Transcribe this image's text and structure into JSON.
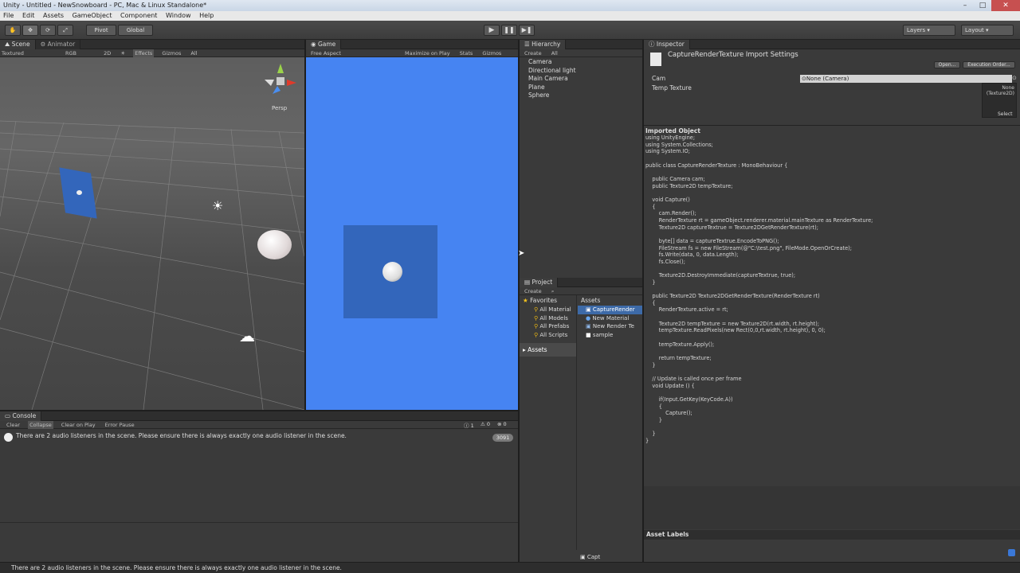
{
  "window": {
    "title": "Unity - Untitled - NewSnowboard - PC, Mac & Linux Standalone*",
    "controls": [
      "–",
      "□",
      "✕"
    ]
  },
  "menu": [
    "File",
    "Edit",
    "Assets",
    "GameObject",
    "Component",
    "Window",
    "Help"
  ],
  "toolbar": {
    "pivot": "Pivot",
    "global": "Global",
    "layers": "Layers",
    "layout": "Layout"
  },
  "scene": {
    "tabs": [
      "Scene",
      "Animator"
    ],
    "shading": "Textured",
    "render_mode": "RGB",
    "mode_2d": "2D",
    "effects": "Effects",
    "gizmos": "Gizmos",
    "search": "All",
    "persp": "Persp"
  },
  "game": {
    "tab": "Game",
    "aspect": "Free Aspect",
    "maximize": "Maximize on Play",
    "stats": "Stats",
    "gizmos": "Gizmos"
  },
  "hierarchy": {
    "tab": "Hierarchy",
    "create": "Create",
    "search": "All",
    "items": [
      "Camera",
      "Directional light",
      "Main Camera",
      "Plane",
      "Sphere"
    ]
  },
  "project": {
    "tab": "Project",
    "create": "Create",
    "favorites_label": "Favorites",
    "favorites": [
      "All Material",
      "All Models",
      "All Prefabs",
      "All Scripts"
    ],
    "assets_root": "Assets",
    "assets_header": "Assets",
    "assets": [
      "CaptureRender",
      "New Material",
      "New Render Te",
      "sample"
    ],
    "footer_item": "Capt"
  },
  "inspector": {
    "tab": "Inspector",
    "title": "CaptureRenderTexture Import Settings",
    "open_button": "Open...",
    "exec_order_button": "Execution Order...",
    "fields": [
      {
        "label": "Cam",
        "value": "None (Camera)"
      },
      {
        "label": "Temp Texture",
        "value": ""
      }
    ],
    "texture_preview": "None\n(Texture2D)",
    "select_button": "Select",
    "imported_object_label": "Imported Object",
    "code": "using UnityEngine;\nusing System.Collections;\nusing System.IO;\n\npublic class CaptureRenderTexture : MonoBehaviour {\n\n    public Camera cam;\n    public Texture2D tempTexture;\n\n    void Capture()\n    {\n        cam.Render();\n        RenderTexture rt = gameObject.renderer.material.mainTexture as RenderTexture;\n        Texture2D captureTextrue = Texture2DGetRenderTexture(rt);\n\n        byte[] data = captureTextrue.EncodeToPNG();\n        FileStream fs = new FileStream(@\"C:\\test.png\", FileMode.OpenOrCreate);\n        fs.Write(data, 0, data.Length);\n        fs.Close();\n\n        Texture2D.DestroyImmediate(captureTextrue, true);\n    }\n\n    public Texture2D Texture2DGetRenderTexture(RenderTexture rt)\n    {\n        RenderTexture.active = rt;\n\n        Texture2D tempTexture = new Texture2D(rt.width, rt.height);\n        tempTexture.ReadPixels(new Rect(0,0,rt.width, rt.height), 0, 0);\n\n        tempTexture.Apply();\n\n        return tempTexture;\n    }\n\n    // Update is called once per frame\n    void Update () {\n\n        if(Input.GetKey(KeyCode.A))\n        {\n            Capture();\n        }\n\n    }\n}",
    "asset_labels": "Asset Labels"
  },
  "console": {
    "tab": "Console",
    "buttons": [
      "Clear",
      "Collapse",
      "Clear on Play",
      "Error Pause"
    ],
    "counts": {
      "log": "1",
      "warn": "0",
      "error": "0"
    },
    "message": "There are 2 audio listeners in the scene. Please ensure there is always exactly one audio listener in the scene.",
    "message_count": "3091"
  },
  "status_bar": {
    "message": "There are 2 audio listeners in the scene. Please ensure there is always exactly one audio listener in the scene."
  },
  "colors": {
    "game_bg": "#4684f2",
    "quad": "#3366bb",
    "panel": "#3a3a3a"
  }
}
